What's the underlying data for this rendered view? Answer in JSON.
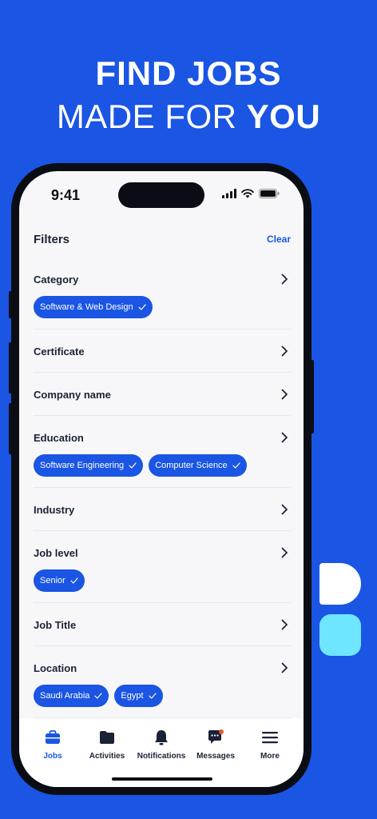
{
  "headline": {
    "line1": "FIND JOBS",
    "line2_prefix": "MADE FOR ",
    "line2_bold": "YOU"
  },
  "status_bar": {
    "time": "9:41"
  },
  "filters": {
    "title": "Filters",
    "clear_label": "Clear"
  },
  "sections": [
    {
      "label": "Category",
      "chips": [
        "Software & Web Design"
      ]
    },
    {
      "label": "Certificate",
      "chips": []
    },
    {
      "label": "Company name",
      "chips": []
    },
    {
      "label": "Education",
      "chips": [
        "Software Engineering",
        "Computer Science"
      ]
    },
    {
      "label": "Industry",
      "chips": []
    },
    {
      "label": "Job level",
      "chips": [
        "Senior"
      ]
    },
    {
      "label": "Job Title",
      "chips": []
    },
    {
      "label": "Location",
      "chips": [
        "Saudi Arabia",
        "Egypt"
      ]
    }
  ],
  "tabs": [
    {
      "label": "Jobs",
      "icon": "briefcase-icon",
      "active": true
    },
    {
      "label": "Activities",
      "icon": "folder-icon",
      "active": false
    },
    {
      "label": "Notifications",
      "icon": "bell-icon",
      "active": false
    },
    {
      "label": "Messages",
      "icon": "chat-icon",
      "active": false
    },
    {
      "label": "More",
      "icon": "menu-icon",
      "active": false
    }
  ],
  "colors": {
    "background": "#1a55e3",
    "accent": "#1a55e3",
    "logo_secondary": "#6ee6ff"
  }
}
